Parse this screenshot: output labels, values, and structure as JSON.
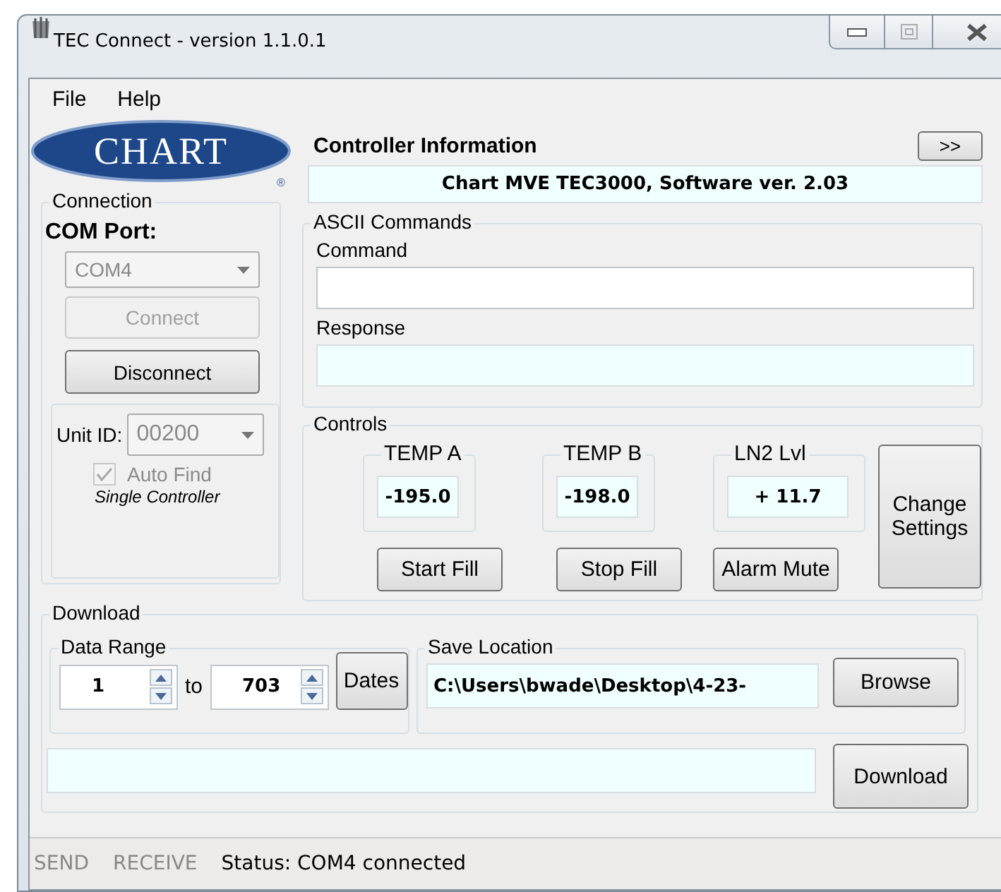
{
  "window": {
    "title": "TEC Connect - version 1.1.0.1"
  },
  "menu": [
    {
      "label": "File"
    },
    {
      "label": "Help"
    }
  ],
  "logo": {
    "text": "CHART",
    "mark": "®"
  },
  "connection": {
    "title": "Connection",
    "com_port_label": "COM Port:",
    "com_port": {
      "value": "COM4",
      "disabled": true
    },
    "connect_button": {
      "label": "Connect",
      "disabled": true
    },
    "disconnect_button": {
      "label": "Disconnect",
      "disabled": false
    },
    "unit_id_label": "Unit ID:",
    "unit_id": {
      "value": "00200",
      "disabled": true
    },
    "auto_find": {
      "label": "Auto Find",
      "checked": true,
      "disabled": true
    },
    "mode_note": "Single Controller"
  },
  "controller_info": {
    "title": "Controller Information",
    "expand_button": ">>",
    "info": "Chart MVE TEC3000, Software ver.  2.03"
  },
  "ascii_commands": {
    "title": "ASCII Commands",
    "command_label": "Command",
    "response_label": "Response"
  },
  "controls": {
    "title": "Controls",
    "readouts": [
      {
        "label": "TEMP A",
        "value": "-195.0"
      },
      {
        "label": "TEMP B",
        "value": "-198.0"
      },
      {
        "label": "LN2 Lvl",
        "value": "+ 11.7"
      }
    ],
    "buttons": [
      {
        "label": "Start Fill"
      },
      {
        "label": "Stop Fill"
      },
      {
        "label": "Alarm Mute"
      }
    ],
    "change_settings_button": "Change Settings"
  },
  "download": {
    "title": "Download",
    "data_range": {
      "title": "Data Range",
      "from": "1",
      "to_label": "to",
      "to": "703",
      "dates_button": "Dates"
    },
    "save_location": {
      "title": "Save Location",
      "path": "C:\\Users\\bwade\\Desktop\\4-23-",
      "browse_button": "Browse"
    },
    "download_button": "Download"
  },
  "status_bar": {
    "indicators": [
      {
        "label": "SEND",
        "active": false
      },
      {
        "label": "RECEIVE",
        "active": false
      }
    ],
    "status": "Status: COM4 connected"
  }
}
